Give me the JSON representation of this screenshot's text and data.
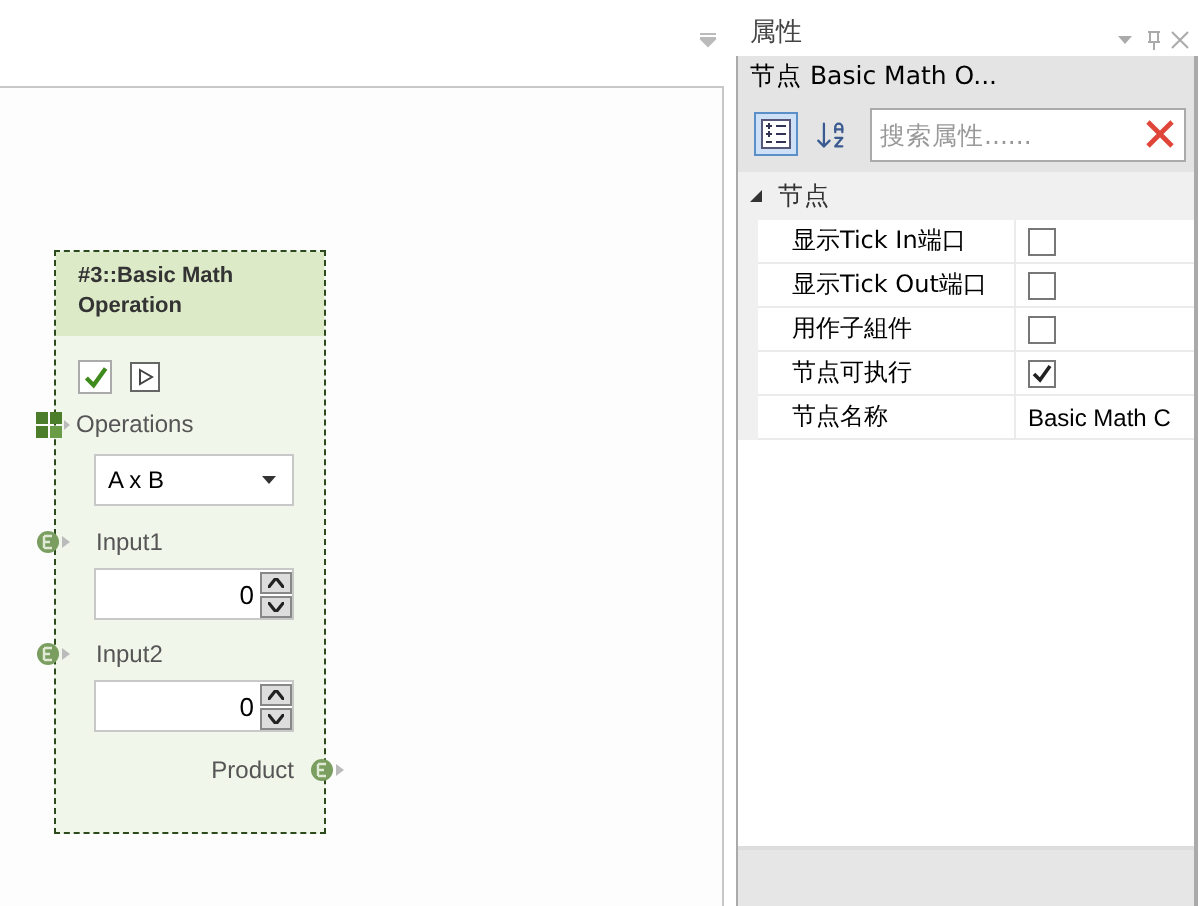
{
  "canvas": {
    "node": {
      "title": "#3::Basic Math Operation",
      "enabled": true,
      "operations_label": "Operations",
      "operation": "A x B",
      "inputs": [
        {
          "label": "Input1",
          "value": "0"
        },
        {
          "label": "Input2",
          "value": "0"
        }
      ],
      "output": {
        "label": "Product"
      }
    }
  },
  "properties_panel": {
    "title": "属性",
    "header": "节点 Basic Math O...",
    "search": {
      "placeholder": "搜索属性......"
    },
    "category": {
      "label": "节点",
      "expanded": true,
      "rows": [
        {
          "name": "显示Tick In端口",
          "kind": "checkbox",
          "checked": false
        },
        {
          "name": "显示Tick Out端口",
          "kind": "checkbox",
          "checked": false
        },
        {
          "name": "用作子組件",
          "kind": "checkbox",
          "checked": false
        },
        {
          "name": "节点可执行",
          "kind": "checkbox",
          "checked": true
        },
        {
          "name": "节点名称",
          "kind": "text",
          "value": "Basic Math C"
        }
      ]
    }
  }
}
